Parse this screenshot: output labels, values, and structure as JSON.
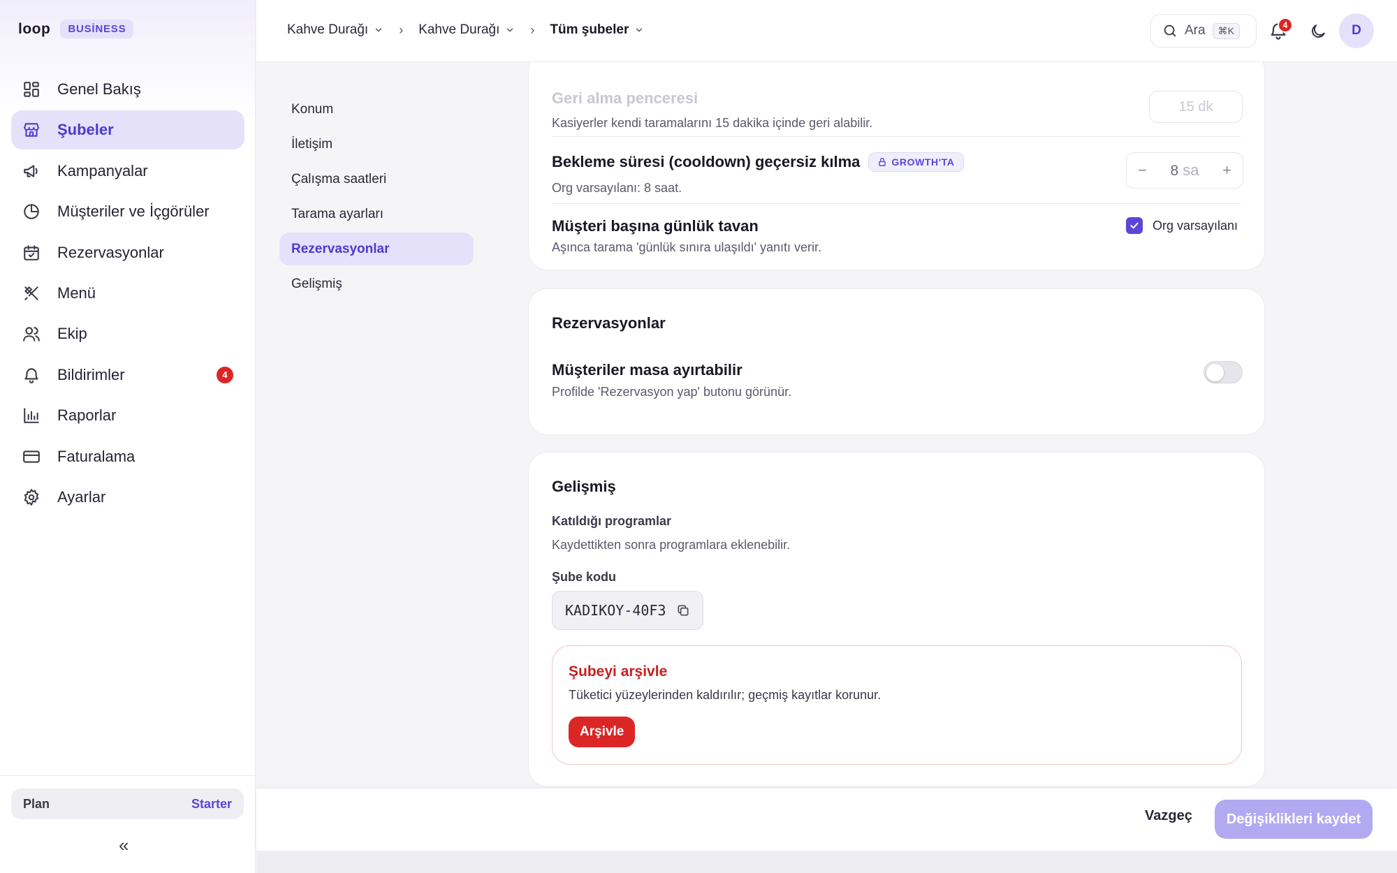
{
  "brand": {
    "logo": "loop",
    "badge": "BUSİNESS"
  },
  "sidebar": {
    "items": [
      {
        "label": "Genel Bakış",
        "icon": "dashboard-icon"
      },
      {
        "label": "Şubeler",
        "icon": "store-icon",
        "active": true
      },
      {
        "label": "Kampanyalar",
        "icon": "megaphone-icon"
      },
      {
        "label": "Müşteriler ve İçgörüler",
        "icon": "pie-chart-icon"
      },
      {
        "label": "Rezervasyonlar",
        "icon": "calendar-check-icon"
      },
      {
        "label": "Menü",
        "icon": "utensils-icon"
      },
      {
        "label": "Ekip",
        "icon": "users-icon"
      },
      {
        "label": "Bildirimler",
        "icon": "bell-icon",
        "badge": "4"
      },
      {
        "label": "Raporlar",
        "icon": "bar-chart-icon"
      },
      {
        "label": "Faturalama",
        "icon": "credit-card-icon"
      },
      {
        "label": "Ayarlar",
        "icon": "gear-icon"
      }
    ],
    "plan_label": "Plan",
    "plan_value": "Starter",
    "collapse_glyph": "«"
  },
  "topbar": {
    "breadcrumbs": [
      "Kahve Durağı",
      "Kahve Durağı",
      "Tüm şubeler"
    ],
    "search_label": "Ara",
    "search_shortcut": "⌘K",
    "notification_count": "4",
    "avatar_initial": "D"
  },
  "subnav": {
    "items": [
      "Konum",
      "İletişim",
      "Çalışma saatleri",
      "Tarama ayarları",
      "Rezervasyonlar",
      "Gelişmiş"
    ],
    "active": "Rezervasyonlar"
  },
  "scan_settings": {
    "undo_title_partial": "Geri alma penceresi",
    "undo_sub": "Kasiyerler kendi taramalarını 15 dakika içinde geri alabilir.",
    "undo_value": "15 dk",
    "cooldown_title": "Bekleme süresi (cooldown) geçersiz kılma",
    "cooldown_tag": "GROWTH'TA",
    "cooldown_sub": "Org varsayılanı: 8 saat.",
    "cooldown_value": "8",
    "cooldown_unit": "sa",
    "daily_cap_title": "Müşteri başına günlük tavan",
    "daily_cap_sub": "Aşınca tarama 'günlük sınıra ulaşıldı' yanıtı verir.",
    "daily_cap_checkbox_label": "Org varsayılanı",
    "daily_cap_checked": true
  },
  "reservations": {
    "title": "Rezervasyonlar",
    "option_title": "Müşteriler masa ayırtabilir",
    "option_sub": "Profilde 'Rezervasyon yap' butonu görünür.",
    "enabled": false
  },
  "advanced": {
    "title": "Gelişmiş",
    "programs_label": "Katıldığı programlar",
    "programs_sub": "Kaydettikten sonra programlara eklenebilir.",
    "code_label": "Şube kodu",
    "code_value": "KADIKOY-40F3",
    "archive_title": "Şubeyi arşivle",
    "archive_sub": "Tüketici yüzeylerinden kaldırılır; geçmiş kayıtlar korunur.",
    "archive_button": "Arşivle"
  },
  "footer": {
    "cancel": "Vazgeç",
    "save": "Değişiklikleri kaydet"
  },
  "colors": {
    "accent": "#5a46d6",
    "accent_light": "#e6e1fb",
    "danger": "#dc2626",
    "save_disabled": "#b3a9f1"
  }
}
